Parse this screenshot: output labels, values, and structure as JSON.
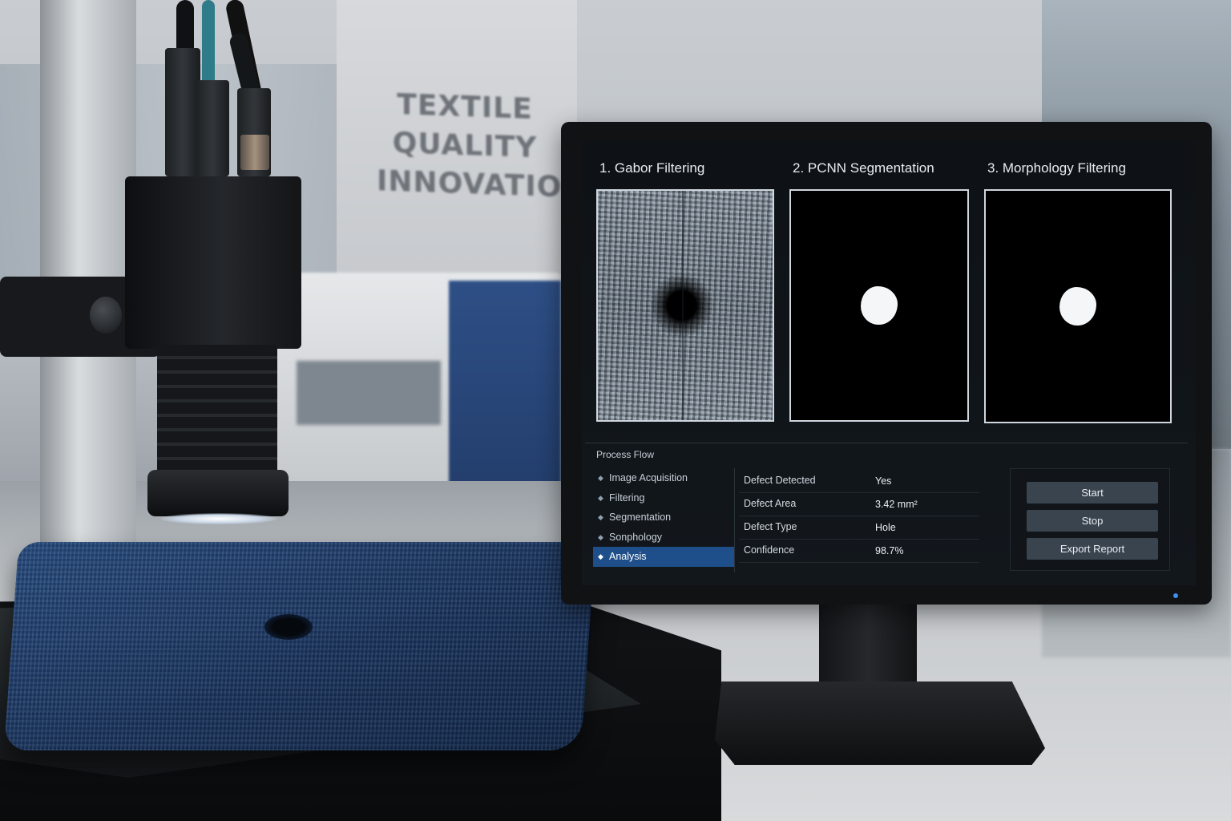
{
  "scene": {
    "wall_sign": [
      "TEXTILE",
      "QUALITY",
      "INNOVATION"
    ]
  },
  "screen": {
    "panels": [
      {
        "title": "1. Gabor Filtering"
      },
      {
        "title": "2. PCNN Segmentation"
      },
      {
        "title": "3. Morphology Filtering"
      }
    ],
    "process_flow": {
      "title": "Process Flow",
      "items": [
        "Image Acquisition",
        "Filtering",
        "Segmentation",
        "Sonphology",
        "Analysis"
      ],
      "active_index": 4
    },
    "metrics": [
      {
        "label": "Defect Detected",
        "value": "Yes"
      },
      {
        "label": "Defect Area",
        "value": "3.42 mm²"
      },
      {
        "label": "Defect Type",
        "value": "Hole"
      },
      {
        "label": "Confidence",
        "value": "98.7%"
      }
    ],
    "buttons": {
      "start": "Start",
      "stop": "Stop",
      "export": "Export Report"
    }
  },
  "colors": {
    "active_item": "#1f4f8a",
    "button": "#3a444f",
    "fabric": "#1b3660",
    "machine_blue": "#2e4f86",
    "power_led": "#3f8ff0"
  }
}
